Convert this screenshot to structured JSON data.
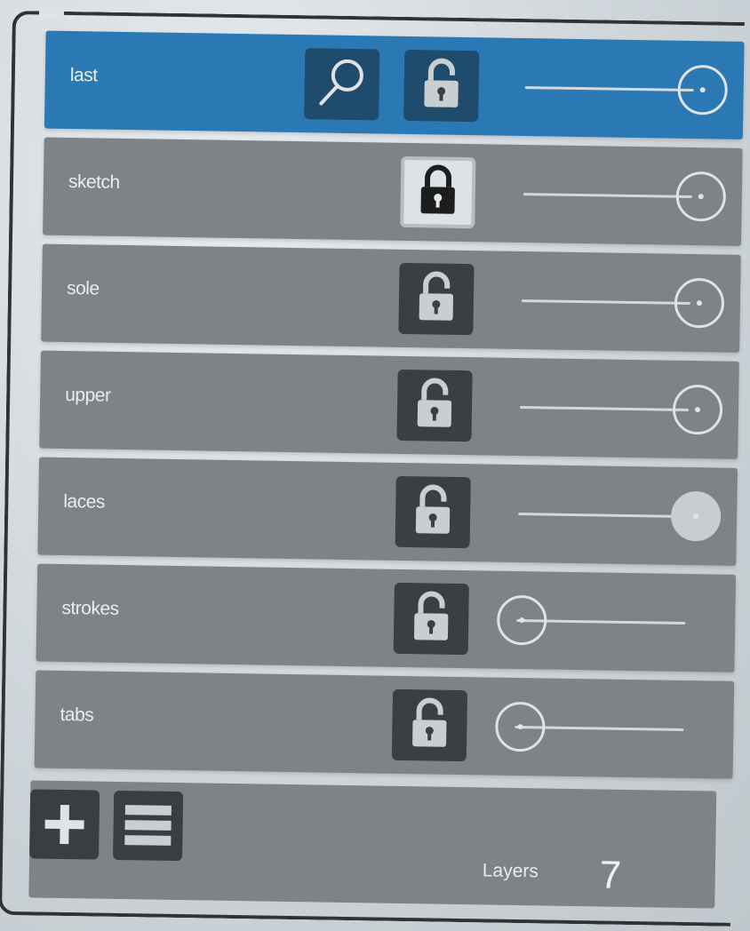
{
  "layers": [
    {
      "name": "last",
      "active": true,
      "has_search": true,
      "locked": false,
      "opacity": 0.97
    },
    {
      "name": "sketch",
      "active": false,
      "has_search": false,
      "locked": true,
      "opacity": 0.97
    },
    {
      "name": "sole",
      "active": false,
      "has_search": false,
      "locked": false,
      "opacity": 0.97
    },
    {
      "name": "upper",
      "active": false,
      "has_search": false,
      "locked": false,
      "opacity": 0.97
    },
    {
      "name": "laces",
      "active": false,
      "has_search": false,
      "locked": false,
      "opacity": 0.97
    },
    {
      "name": "strokes",
      "active": false,
      "has_search": false,
      "locked": false,
      "opacity": 0.0
    },
    {
      "name": "tabs",
      "active": false,
      "has_search": false,
      "locked": false,
      "opacity": 0.0
    }
  ],
  "footer": {
    "add_icon": "plus-icon",
    "menu_icon": "layers-menu-icon",
    "layers_label": "Layers",
    "layers_count": "7"
  },
  "colors": {
    "active_row": "#2a79b4",
    "row": "#7e8388",
    "button": "#3b3f43",
    "locked_button": "#dfe2e4"
  }
}
